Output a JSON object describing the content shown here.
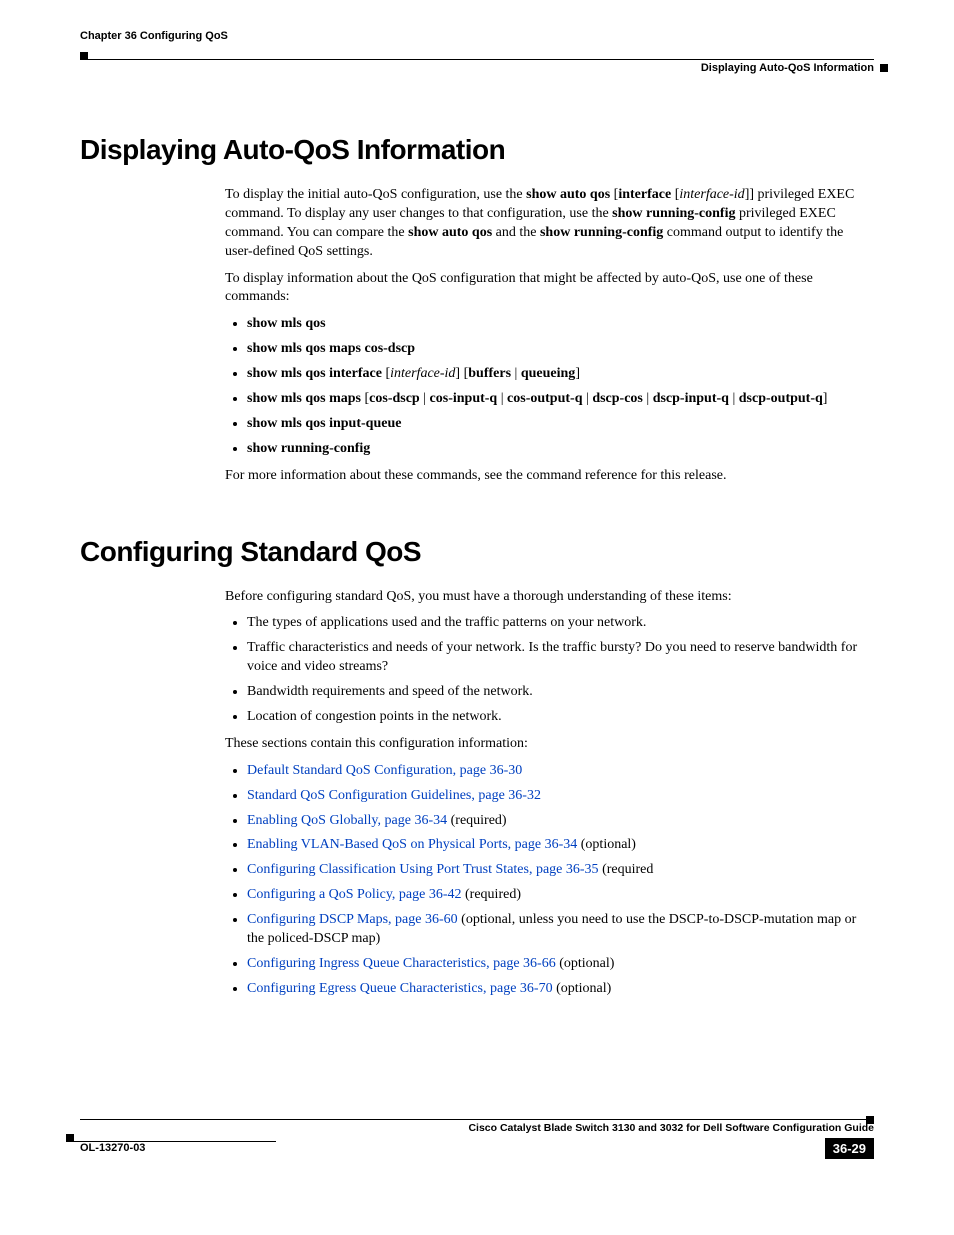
{
  "header": {
    "chapter": "Chapter 36    Configuring QoS",
    "section": "Displaying Auto-QoS Information"
  },
  "h1_a": "Displaying Auto-QoS Information",
  "para1": {
    "t1": "To display the initial auto-QoS configuration, use the ",
    "b1": "show auto qos",
    "t2": " [",
    "b2": "interface",
    "t3": " [",
    "i1": "interface-id",
    "t4": "]] privileged EXEC command. To display any user changes to that configuration, use the ",
    "b3": "show running-config",
    "t5": " privileged EXEC command. You can compare the ",
    "b4": "show auto qos",
    "t6": " and the ",
    "b5": "show running-config",
    "t7": " command output to identify the user-defined QoS settings."
  },
  "para2": "To display information about the QoS configuration that might be affected by auto-QoS, use one of these commands:",
  "cmds": {
    "c1": "show mls qos",
    "c2": "show mls qos maps cos-dscp",
    "c3_a": "show mls qos interface",
    "c3_b": " [",
    "c3_c": "interface-id",
    "c3_d": "] [",
    "c3_e": "buffers",
    "c3_f": " | ",
    "c3_g": "queueing",
    "c3_h": "]",
    "c4_a": "show mls qos maps",
    "c4_b": " [",
    "c4_c": "cos-dscp",
    "c4_d": " | ",
    "c4_e": "cos-input-q",
    "c4_f": " | ",
    "c4_g": "cos-output-q",
    "c4_h": " | ",
    "c4_i": "dscp-cos",
    "c4_j": " | ",
    "c4_k": "dscp-input-q",
    "c4_l": " | ",
    "c4_m": "dscp-output-q",
    "c4_n": "]",
    "c5": "show mls qos input-queue",
    "c6": "show running-config"
  },
  "para3": "For more information about these commands, see the command reference for this release.",
  "h1_b": "Configuring Standard QoS",
  "para4": "Before configuring standard QoS, you must have a thorough understanding of these items:",
  "items": {
    "i1": "The types of applications used and the traffic patterns on your network.",
    "i2": "Traffic characteristics and needs of your network. Is the traffic bursty? Do you need to reserve bandwidth for voice and video streams?",
    "i3": "Bandwidth requirements and speed of the network.",
    "i4": "Location of congestion points in the network."
  },
  "para5": "These sections contain this configuration information:",
  "links": {
    "l1": "Default Standard QoS Configuration, page 36-30",
    "l2": "Standard QoS Configuration Guidelines, page 36-32",
    "l3": "Enabling QoS Globally, page 36-34",
    "l3s": " (required)",
    "l4": "Enabling VLAN-Based QoS on Physical Ports, page 36-34",
    "l4s": " (optional)",
    "l5": "Configuring Classification Using Port Trust States, page 36-35",
    "l5s": " (required",
    "l6": "Configuring a QoS Policy, page 36-42",
    "l6s": " (required)",
    "l7": "Configuring DSCP Maps, page 36-60",
    "l7s": " (optional, unless you need to use the DSCP-to-DSCP-mutation map or the policed-DSCP map)",
    "l8": "Configuring Ingress Queue Characteristics, page 36-66",
    "l8s": " (optional)",
    "l9": "Configuring Egress Queue Characteristics, page 36-70",
    "l9s": " (optional)"
  },
  "footer": {
    "title": "Cisco Catalyst Blade Switch 3130 and 3032 for Dell Software Configuration Guide",
    "docnum": "OL-13270-03",
    "pagenum": "36-29"
  }
}
